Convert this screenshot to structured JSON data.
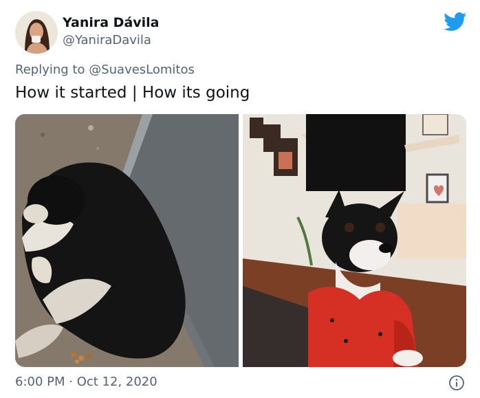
{
  "author": {
    "name": "Yanira Dávila",
    "handle": "@YaniraDavila"
  },
  "reply": {
    "prefix": "Replying to ",
    "mention": "@SuavesLomitos"
  },
  "tweet": {
    "text": "How it started | How its going"
  },
  "meta": {
    "time": "6:00 PM",
    "separator": " · ",
    "date": "Oct 12, 2020"
  },
  "colors": {
    "brand": "#1d9bf0",
    "text_primary": "#0f1419",
    "text_secondary": "#536471"
  },
  "icons": {
    "logo": "twitter-bird-icon",
    "info": "info-icon"
  }
}
